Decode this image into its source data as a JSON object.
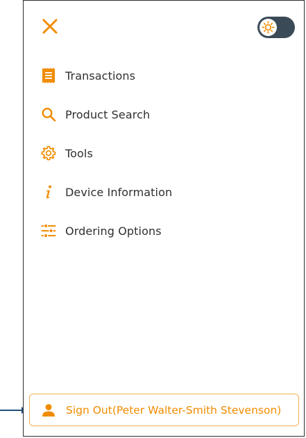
{
  "colors": {
    "accent": "#F08C00",
    "toggle_track": "#3A4A57",
    "text": "#2F2F2F",
    "pointer": "#1F4E79"
  },
  "header": {
    "close_icon": "close-icon",
    "theme_toggle_icon": "sun-icon"
  },
  "menu": {
    "items": [
      {
        "label": "Transactions",
        "icon": "receipt-icon"
      },
      {
        "label": "Product Search",
        "icon": "search-icon"
      },
      {
        "label": "Tools",
        "icon": "gear-icon"
      },
      {
        "label": "Device Information",
        "icon": "info-icon"
      },
      {
        "label": "Ordering Options",
        "icon": "sliders-icon"
      }
    ]
  },
  "footer": {
    "signout_label": "Sign Out(Peter Walter-Smith Stevenson)",
    "signout_icon": "user-icon"
  }
}
